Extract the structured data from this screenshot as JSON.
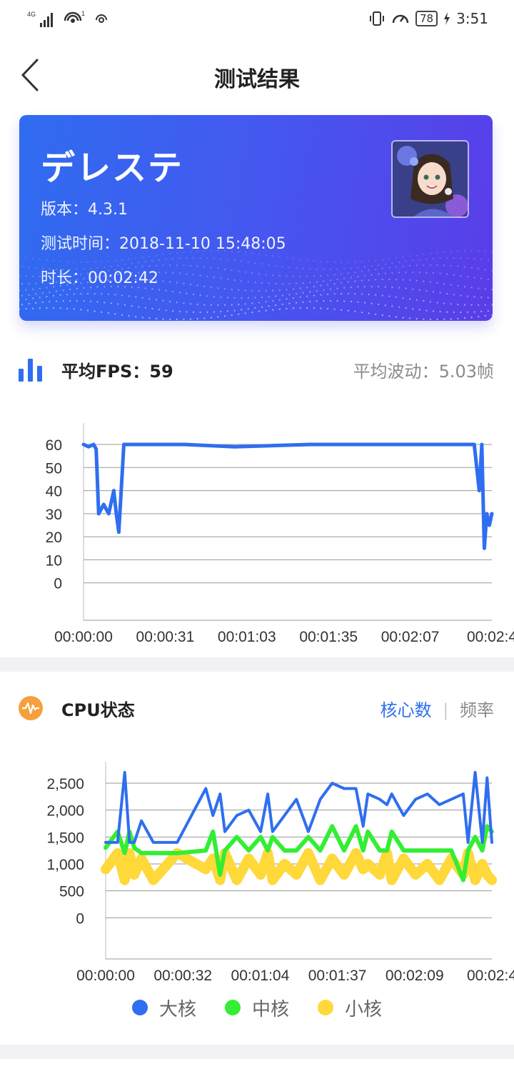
{
  "status_bar": {
    "network": "4G",
    "time": "3:51",
    "battery": "78",
    "notification_count": "1"
  },
  "nav": {
    "title": "测试结果"
  },
  "app_card": {
    "name": "デレステ",
    "version_label": "版本：",
    "version": "4.3.1",
    "test_time_label": "测试时间：",
    "test_time": "2018-11-10 15:48:05",
    "duration_label": "时长：",
    "duration": "00:02:42"
  },
  "fps_section": {
    "avg_fps_label": "平均FPS：",
    "avg_fps": "59",
    "avg_fluct_label": "平均波动：",
    "avg_fluct": "5.03帧",
    "icon": "bar-chart-icon"
  },
  "cpu_section": {
    "title": "CPU状态",
    "tab_cores": "核心数",
    "tab_freq": "频率",
    "icon": "pulse-icon"
  },
  "colors": {
    "accent_blue": "#2f6ef0",
    "card_start": "#2f6cf0",
    "card_end": "#5a3de8",
    "big_core": "#2f6ef0",
    "mid_core": "#33ee33",
    "small_core": "#ffd83a",
    "cpu_icon": "#f5a03c"
  },
  "chart_data": [
    {
      "type": "line",
      "title": "",
      "xlabel": "",
      "ylabel": "",
      "x_ticks": [
        "00:00:00",
        "00:00:31",
        "00:01:03",
        "00:01:35",
        "00:02:07",
        "00:02:4"
      ],
      "y_ticks": [
        "60",
        "50",
        "40",
        "30",
        "20",
        "10",
        "0"
      ],
      "ylim": [
        0,
        60
      ],
      "grid": true,
      "x_unit": "seconds",
      "x": [
        0,
        2,
        4,
        5,
        6,
        8,
        10,
        12,
        13,
        14,
        16,
        18,
        20,
        22,
        40,
        60,
        90,
        120,
        140,
        155,
        157,
        158,
        159,
        160,
        161,
        162
      ],
      "series": [
        {
          "values": [
            60,
            59,
            60,
            58,
            30,
            34,
            30,
            40,
            30,
            22,
            60,
            60,
            60,
            60,
            60,
            59,
            60,
            60,
            60,
            60,
            40,
            60,
            15,
            30,
            25,
            30
          ]
        }
      ]
    },
    {
      "type": "line",
      "title": "",
      "xlabel": "",
      "ylabel": "",
      "x_ticks": [
        "00:00:00",
        "00:00:32",
        "00:01:04",
        "00:01:37",
        "00:02:09",
        "00:02:4"
      ],
      "y_ticks": [
        "2,500",
        "2,000",
        "1,500",
        "1,000",
        "500",
        "0"
      ],
      "ylim": [
        0,
        2500
      ],
      "grid": true,
      "x_unit": "seconds",
      "x": [
        0,
        5,
        8,
        10,
        12,
        15,
        20,
        30,
        42,
        45,
        48,
        50,
        55,
        60,
        65,
        68,
        70,
        75,
        80,
        85,
        90,
        95,
        100,
        105,
        108,
        110,
        115,
        118,
        120,
        125,
        130,
        135,
        140,
        145,
        150,
        152,
        155,
        158,
        160,
        162
      ],
      "series": [
        {
          "name": "大核",
          "values": [
            1400,
            1400,
            2700,
            1400,
            1400,
            1800,
            1400,
            1400,
            2400,
            1900,
            2300,
            1600,
            1900,
            2000,
            1600,
            2300,
            1600,
            1900,
            2200,
            1600,
            2200,
            2500,
            2400,
            2400,
            1700,
            2300,
            2200,
            2100,
            2300,
            1900,
            2200,
            2300,
            2100,
            2200,
            2300,
            1400,
            2700,
            1400,
            2600,
            1400
          ]
        },
        {
          "name": "中核",
          "values": [
            1300,
            1600,
            1200,
            1600,
            1300,
            1200,
            1200,
            1200,
            1250,
            1600,
            800,
            1250,
            1500,
            1250,
            1500,
            1250,
            1500,
            1250,
            1250,
            1500,
            1250,
            1700,
            1250,
            1700,
            1250,
            1600,
            1250,
            1250,
            1600,
            1250,
            1250,
            1250,
            1250,
            1250,
            700,
            1250,
            1500,
            1250,
            1700,
            1600
          ]
        },
        {
          "name": "小核",
          "values": [
            900,
            1200,
            700,
            1200,
            800,
            1100,
            700,
            1200,
            900,
            1100,
            700,
            1200,
            700,
            1100,
            800,
            1200,
            700,
            1000,
            800,
            1200,
            700,
            1100,
            800,
            1200,
            900,
            1000,
            800,
            1200,
            700,
            1100,
            800,
            1000,
            700,
            1100,
            800,
            1200,
            700,
            1000,
            800,
            700
          ]
        }
      ]
    }
  ]
}
